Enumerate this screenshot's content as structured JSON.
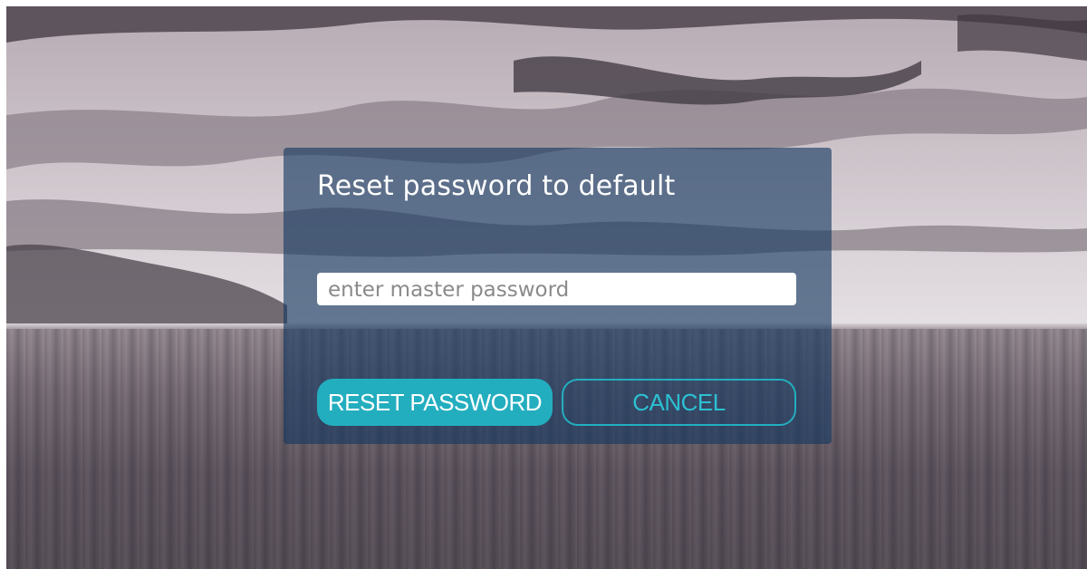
{
  "dialog": {
    "title": "Reset password to default",
    "password_field": {
      "placeholder": "enter master password",
      "value": ""
    },
    "reset_button_label": "RESET PASSWORD",
    "cancel_button_label": "CANCEL"
  },
  "colors": {
    "dialog_background": "#14375f",
    "accent": "#23aebf",
    "title_text": "#ffffff",
    "input_background": "#ffffff"
  }
}
